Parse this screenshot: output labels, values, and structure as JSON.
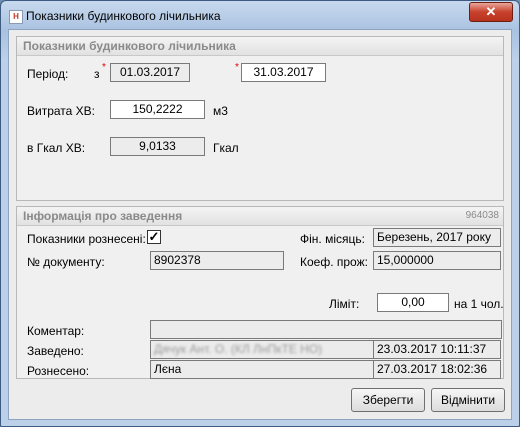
{
  "window": {
    "title": "Показники будинкового лічильника",
    "close_glyph": "✕"
  },
  "meter_panel": {
    "header": "Показники будинкового лічильника",
    "period_label": "Період:",
    "period_from_prefix": "з",
    "period_from": "01.03.2017",
    "period_to": "31.03.2017",
    "consumption_label": "Витрата ХВ:",
    "consumption_value": "150,2222",
    "consumption_unit": "м3",
    "gcal_label": "в Гкал ХВ:",
    "gcal_value": "9,0133",
    "gcal_unit": "Гкал"
  },
  "info_panel": {
    "header": "Інформація про заведення",
    "record_id": "964038",
    "posted_label": "Показники рознесені:",
    "posted_checked": true,
    "check_glyph": "✓",
    "fin_month_label": "Фін. місяць:",
    "fin_month_value": "Березень, 2017 року",
    "doc_no_label": "№ документу:",
    "doc_no_value": "8902378",
    "coef_label": "Коеф. прож:",
    "coef_value": "15,000000",
    "limit_label": "Ліміт:",
    "limit_value": "0,00",
    "limit_unit": "на 1 чол.",
    "comment_label": "Коментар:",
    "comment_value": "",
    "entered_label": "Заведено:",
    "entered_user": "Дячук Ант. О. (КЛ ЛнПкТЕ НО)",
    "entered_time": "23.03.2017 10:11:37",
    "posted_by_label": "Рознесено:",
    "posted_by_user": "Лєна",
    "posted_time": "27.03.2017 18:02:36"
  },
  "buttons": {
    "save": "Зберегти",
    "cancel": "Відмінити"
  },
  "icons": {
    "app": "meter-app-icon",
    "close": "close-icon",
    "check": "checkmark-icon"
  },
  "colors": {
    "close_button": "#c7412c",
    "required_star": "#e00000",
    "title_bar": "#a9c2e1"
  }
}
